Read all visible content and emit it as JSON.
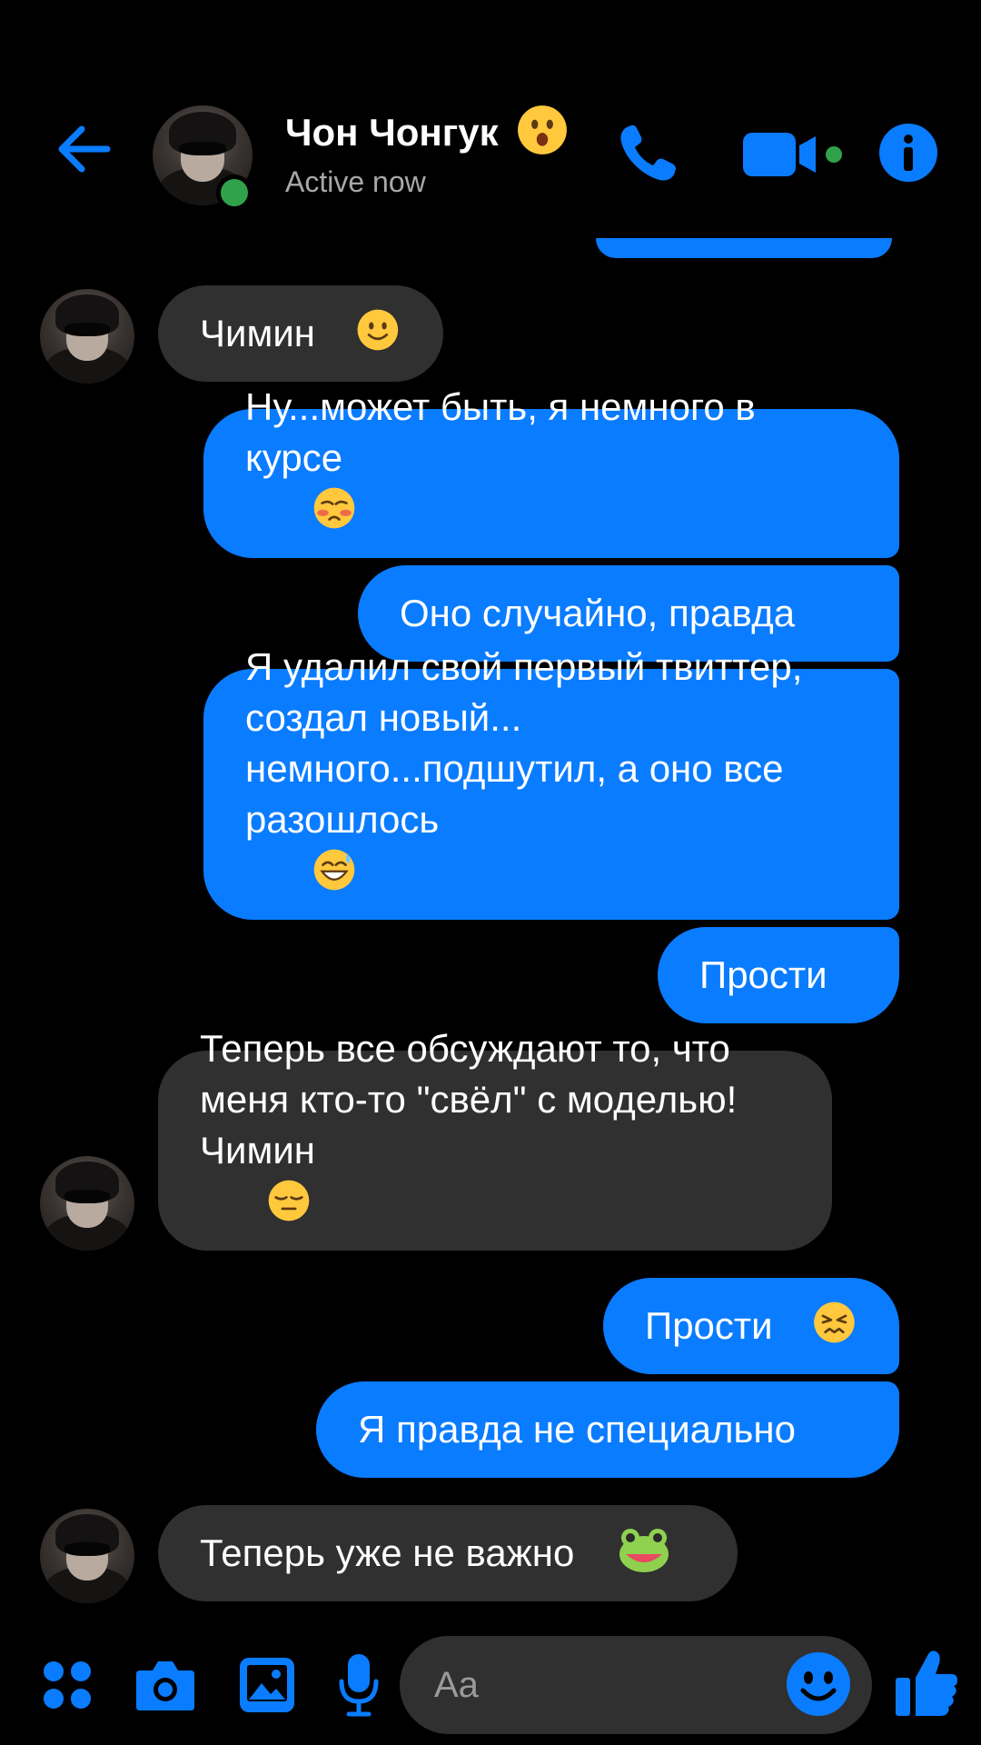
{
  "header": {
    "contact_name": "Чон Чонгук",
    "status": "Active now"
  },
  "messages": [
    {
      "side": "in",
      "text": "Чимин",
      "emoji": "slight-smile"
    },
    {
      "side": "out",
      "text": "Ну...может быть, я немного в курсе",
      "emoji": "flushed-pleading"
    },
    {
      "side": "out",
      "text": "Оно случайно, правда",
      "emoji": ""
    },
    {
      "side": "out",
      "text": "Я удалил свой первый твиттер, создал новый... немного...подшутил, а оно все разошлось",
      "emoji": "sweat-grin"
    },
    {
      "side": "out",
      "text": "Прости",
      "emoji": ""
    },
    {
      "side": "in",
      "text": "Теперь все обсуждают то, что меня кто-то \"свёл\" с моделью! Чимин",
      "emoji": "expressionless"
    },
    {
      "side": "out",
      "text": "Прости",
      "emoji": "confounded"
    },
    {
      "side": "out",
      "text": "Я правда не специально",
      "emoji": ""
    },
    {
      "side": "in",
      "text": "Теперь уже не важно",
      "emoji": "frog"
    }
  ],
  "composer": {
    "placeholder": "Aa"
  },
  "colors": {
    "accent": "#0a7cff",
    "incoming_bubble": "#303030",
    "online": "#31a24c",
    "background": "#000000"
  },
  "icons": [
    "back-arrow-icon",
    "phone-icon",
    "video-camera-icon",
    "info-icon",
    "apps-icon",
    "camera-icon",
    "gallery-icon",
    "microphone-icon",
    "emoji-icon",
    "thumbs-up-icon"
  ]
}
